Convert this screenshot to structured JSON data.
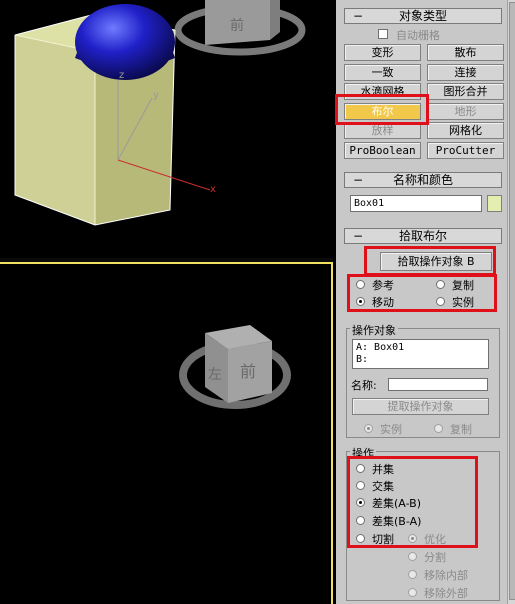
{
  "viewport_top": {
    "axis_labels": {
      "z": "z",
      "y": "y",
      "x": "x"
    }
  },
  "viewport_bottom": {
    "cube_front": "前",
    "cube_left": "左"
  },
  "object_type": {
    "header": "对象类型",
    "auto_grid_label": "自动栅格",
    "buttons": [
      {
        "label": "变形"
      },
      {
        "label": "散布"
      },
      {
        "label": "一致"
      },
      {
        "label": "连接"
      },
      {
        "label": "水滴网格"
      },
      {
        "label": "图形合并"
      },
      {
        "label": "布尔"
      },
      {
        "label": "地形"
      },
      {
        "label": "放样"
      },
      {
        "label": "网格化"
      },
      {
        "label": "ProBoolean"
      },
      {
        "label": "ProCutter"
      }
    ]
  },
  "name_color": {
    "header": "名称和颜色",
    "name_value": "Box01",
    "swatch_color": "#e4eeb0"
  },
  "pick_boolean": {
    "header": "拾取布尔",
    "pick_button": "拾取操作对象 B",
    "radio_reference": "参考",
    "radio_copy": "复制",
    "radio_move": "移动",
    "radio_instance": "实例"
  },
  "operands": {
    "title": "操作对象",
    "list_a": "A: Box01",
    "list_b": "B:",
    "name_label": "名称:",
    "pick_operand": "提取操作对象",
    "radio_instance": "实例",
    "radio_copy": "复制"
  },
  "operation": {
    "title": "操作",
    "union": "并集",
    "intersection": "交集",
    "subtraction_ab": "差集(A-B)",
    "subtraction_ba": "差集(B-A)",
    "cut": "切割",
    "optimize": "优化",
    "split": "分割",
    "remove_inside": "移除内部",
    "remove_outside": "移除外部"
  }
}
